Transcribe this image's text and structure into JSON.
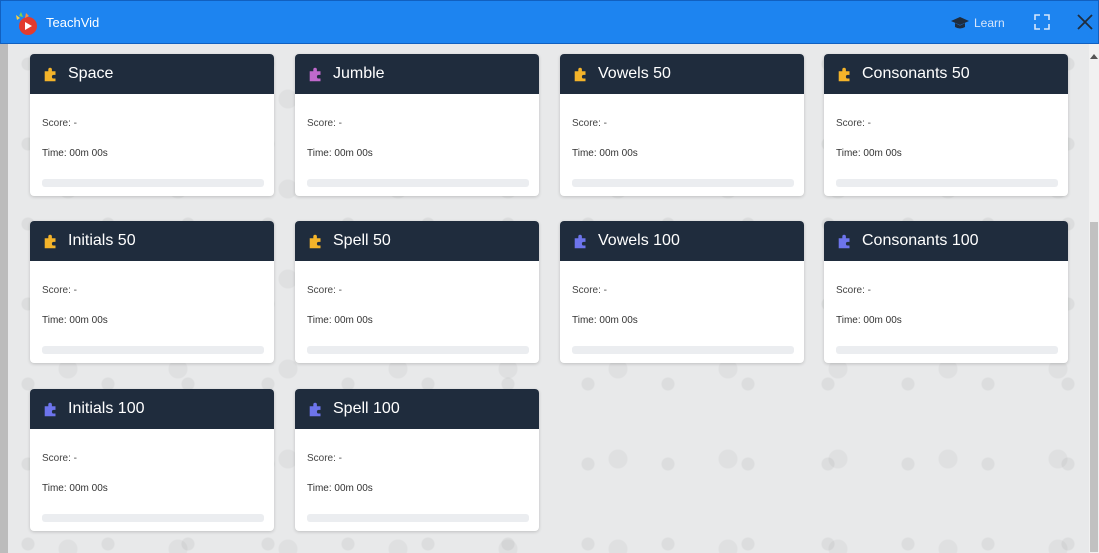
{
  "app": {
    "title": "TeachVid",
    "learn_label": "Learn"
  },
  "colors": {
    "titlebar": "#1d84f0",
    "card_header": "#1f2c3d",
    "icon_yellow": "#f4b42a",
    "icon_purple": "#c069cc",
    "icon_blue": "#6d74ec"
  },
  "cards": [
    {
      "title": "Space",
      "icon": "puzzle-icon",
      "icon_color": "#f4b42a",
      "score": "Score: -",
      "time": "Time: 00m 00s",
      "progress": 0
    },
    {
      "title": "Jumble",
      "icon": "puzzle-icon",
      "icon_color": "#c069cc",
      "score": "Score: -",
      "time": "Time: 00m 00s",
      "progress": 0
    },
    {
      "title": "Vowels 50",
      "icon": "puzzle-icon",
      "icon_color": "#f4b42a",
      "score": "Score: -",
      "time": "Time: 00m 00s",
      "progress": 0
    },
    {
      "title": "Consonants 50",
      "icon": "puzzle-icon",
      "icon_color": "#f4b42a",
      "score": "Score: -",
      "time": "Time: 00m 00s",
      "progress": 0
    },
    {
      "title": "Initials 50",
      "icon": "puzzle-icon",
      "icon_color": "#f4b42a",
      "score": "Score: -",
      "time": "Time: 00m 00s",
      "progress": 0
    },
    {
      "title": "Spell 50",
      "icon": "puzzle-icon",
      "icon_color": "#f4b42a",
      "score": "Score: -",
      "time": "Time: 00m 00s",
      "progress": 0
    },
    {
      "title": "Vowels 100",
      "icon": "puzzle-icon",
      "icon_color": "#6d74ec",
      "score": "Score: -",
      "time": "Time: 00m 00s",
      "progress": 0
    },
    {
      "title": "Consonants 100",
      "icon": "puzzle-icon",
      "icon_color": "#6d74ec",
      "score": "Score: -",
      "time": "Time: 00m 00s",
      "progress": 0
    },
    {
      "title": "Initials 100",
      "icon": "puzzle-icon",
      "icon_color": "#6d74ec",
      "score": "Score: -",
      "time": "Time: 00m 00s",
      "progress": 0
    },
    {
      "title": "Spell 100",
      "icon": "puzzle-icon",
      "icon_color": "#6d74ec",
      "score": "Score: -",
      "time": "Time: 00m 00s",
      "progress": 0
    }
  ]
}
